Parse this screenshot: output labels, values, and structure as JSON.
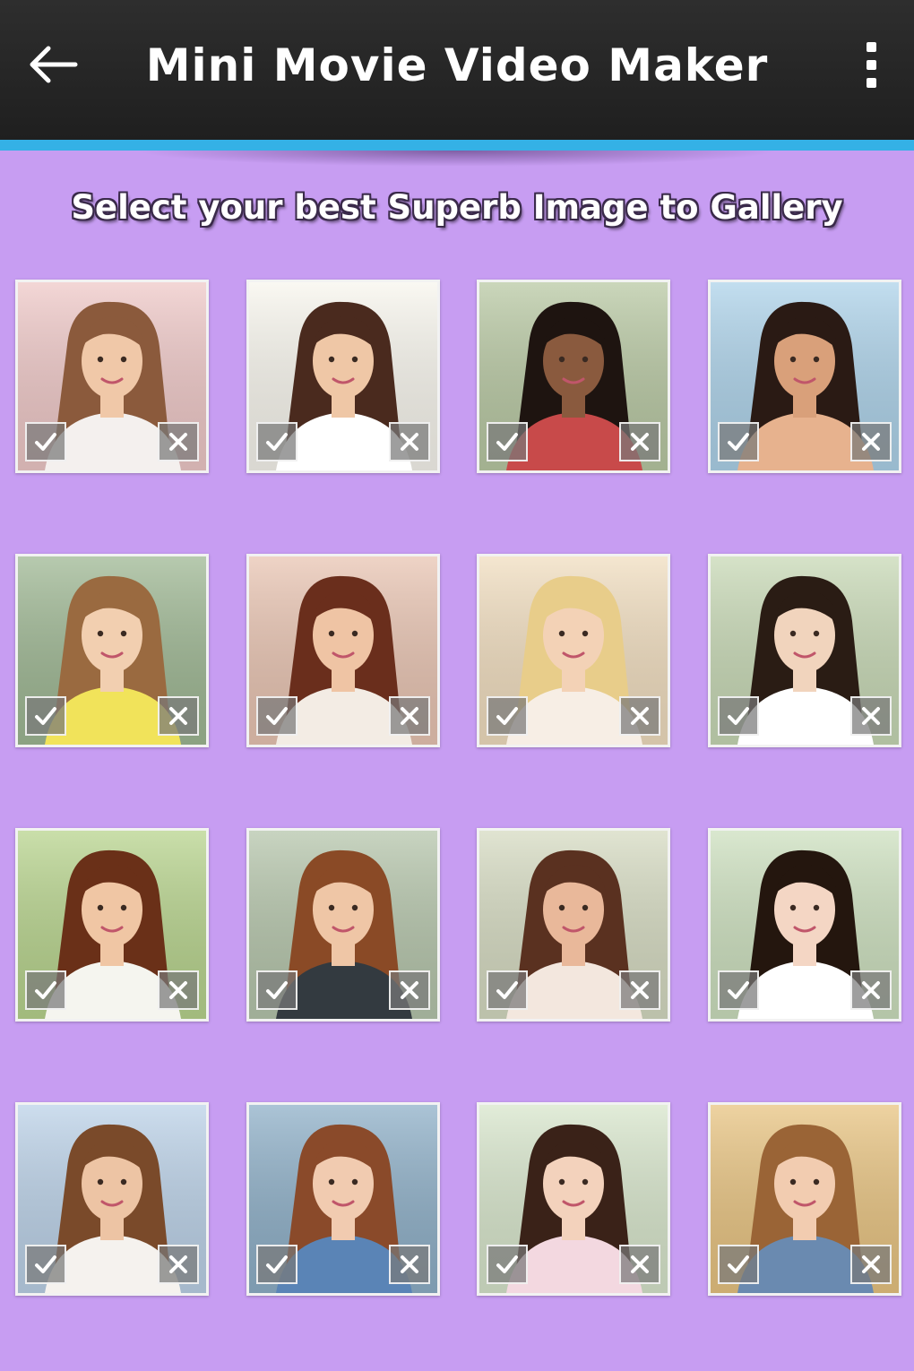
{
  "appbar": {
    "title": "Mini Movie Video Maker",
    "back_icon": "arrow-left-icon",
    "menu_icon": "overflow-menu-icon",
    "accent_color": "#34b1e6"
  },
  "subtitle": "Select your best Superb Image to Gallery",
  "background_color": "#c79df2",
  "gallery": {
    "columns": 4,
    "rows": 4,
    "select_icon": "check-icon",
    "remove_icon": "close-icon",
    "photos": [
      {
        "bg": "#efc9c8",
        "hair": "#8b5a3c",
        "top": "#f4f0ee",
        "skin": "#f0c8a8"
      },
      {
        "bg": "#f8f6ee",
        "hair": "#4a2a1e",
        "top": "#ffffff",
        "skin": "#efc7a6"
      },
      {
        "bg": "#b9c9a4",
        "hair": "#1e1410",
        "top": "#c84a4a",
        "skin": "#8a5a3e"
      },
      {
        "bg": "#aed3ea",
        "hair": "#2a1a14",
        "top": "#e7b28e",
        "skin": "#d9a07a"
      },
      {
        "bg": "#9fb894",
        "hair": "#9a6a40",
        "top": "#f1e35a",
        "skin": "#f2cfb0"
      },
      {
        "bg": "#e9c5b3",
        "hair": "#6a2e1c",
        "top": "#f3ece4",
        "skin": "#efc4a4"
      },
      {
        "bg": "#f1dec0",
        "hair": "#e8cd8a",
        "top": "#f7eee5",
        "skin": "#f3d2b6"
      },
      {
        "bg": "#c8d9b6",
        "hair": "#2a1c14",
        "top": "#ffffff",
        "skin": "#f1d4bd"
      },
      {
        "bg": "#b8d48e",
        "hair": "#6a3018",
        "top": "#f5f5ef",
        "skin": "#f0c6a4"
      },
      {
        "bg": "#b6c6ac",
        "hair": "#8a4a26",
        "top": "#333a40",
        "skin": "#efc6a6"
      },
      {
        "bg": "#d6dbc2",
        "hair": "#5a3120",
        "top": "#f3e7de",
        "skin": "#e9b89a"
      },
      {
        "bg": "#cde0bf",
        "hair": "#24160e",
        "top": "#ffffff",
        "skin": "#f4d6c4"
      },
      {
        "bg": "#bcd2e8",
        "hair": "#7a4a2a",
        "top": "#f5f2ee",
        "skin": "#edc4a4"
      },
      {
        "bg": "#8fb0c8",
        "hair": "#8a4a2a",
        "top": "#5a84b6",
        "skin": "#f1cbb0"
      },
      {
        "bg": "#d8e6cc",
        "hair": "#3a2218",
        "top": "#f3d8e0",
        "skin": "#f3d2bc"
      },
      {
        "bg": "#e8c482",
        "hair": "#9a6436",
        "top": "#6a8ab0",
        "skin": "#f2ccb0"
      }
    ]
  }
}
